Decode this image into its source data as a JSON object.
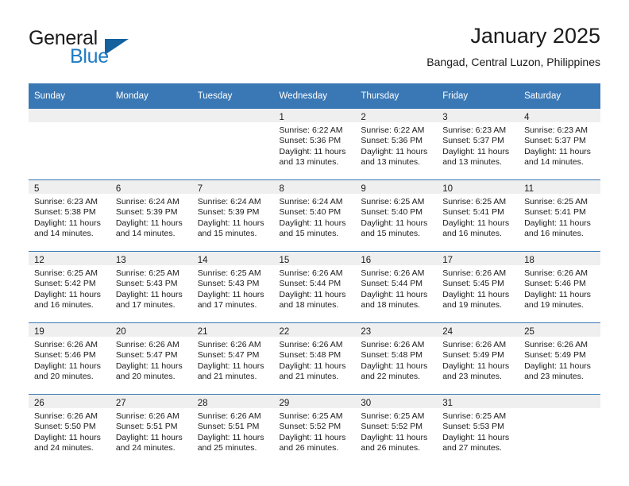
{
  "logo": {
    "word_one": "General",
    "word_two": "Blue",
    "triangle_color": "#15619e",
    "blue_color": "#1e7bc4"
  },
  "header": {
    "title": "January 2025",
    "subtitle": "Bangad, Central Luzon, Philippines"
  },
  "theme": {
    "header_bg": "#3a78b5",
    "daynum_bg": "#efefef",
    "grid_line": "#3a78b5",
    "text": "#1b1b1b"
  },
  "calendar": {
    "weekday_headers": [
      "Sunday",
      "Monday",
      "Tuesday",
      "Wednesday",
      "Thursday",
      "Friday",
      "Saturday"
    ],
    "weeks": [
      [
        {
          "day": "",
          "lines": []
        },
        {
          "day": "",
          "lines": []
        },
        {
          "day": "",
          "lines": []
        },
        {
          "day": "1",
          "lines": [
            "Sunrise: 6:22 AM",
            "Sunset: 5:36 PM",
            "Daylight: 11 hours and 13 minutes."
          ]
        },
        {
          "day": "2",
          "lines": [
            "Sunrise: 6:22 AM",
            "Sunset: 5:36 PM",
            "Daylight: 11 hours and 13 minutes."
          ]
        },
        {
          "day": "3",
          "lines": [
            "Sunrise: 6:23 AM",
            "Sunset: 5:37 PM",
            "Daylight: 11 hours and 13 minutes."
          ]
        },
        {
          "day": "4",
          "lines": [
            "Sunrise: 6:23 AM",
            "Sunset: 5:37 PM",
            "Daylight: 11 hours and 14 minutes."
          ]
        }
      ],
      [
        {
          "day": "5",
          "lines": [
            "Sunrise: 6:23 AM",
            "Sunset: 5:38 PM",
            "Daylight: 11 hours and 14 minutes."
          ]
        },
        {
          "day": "6",
          "lines": [
            "Sunrise: 6:24 AM",
            "Sunset: 5:39 PM",
            "Daylight: 11 hours and 14 minutes."
          ]
        },
        {
          "day": "7",
          "lines": [
            "Sunrise: 6:24 AM",
            "Sunset: 5:39 PM",
            "Daylight: 11 hours and 15 minutes."
          ]
        },
        {
          "day": "8",
          "lines": [
            "Sunrise: 6:24 AM",
            "Sunset: 5:40 PM",
            "Daylight: 11 hours and 15 minutes."
          ]
        },
        {
          "day": "9",
          "lines": [
            "Sunrise: 6:25 AM",
            "Sunset: 5:40 PM",
            "Daylight: 11 hours and 15 minutes."
          ]
        },
        {
          "day": "10",
          "lines": [
            "Sunrise: 6:25 AM",
            "Sunset: 5:41 PM",
            "Daylight: 11 hours and 16 minutes."
          ]
        },
        {
          "day": "11",
          "lines": [
            "Sunrise: 6:25 AM",
            "Sunset: 5:41 PM",
            "Daylight: 11 hours and 16 minutes."
          ]
        }
      ],
      [
        {
          "day": "12",
          "lines": [
            "Sunrise: 6:25 AM",
            "Sunset: 5:42 PM",
            "Daylight: 11 hours and 16 minutes."
          ]
        },
        {
          "day": "13",
          "lines": [
            "Sunrise: 6:25 AM",
            "Sunset: 5:43 PM",
            "Daylight: 11 hours and 17 minutes."
          ]
        },
        {
          "day": "14",
          "lines": [
            "Sunrise: 6:25 AM",
            "Sunset: 5:43 PM",
            "Daylight: 11 hours and 17 minutes."
          ]
        },
        {
          "day": "15",
          "lines": [
            "Sunrise: 6:26 AM",
            "Sunset: 5:44 PM",
            "Daylight: 11 hours and 18 minutes."
          ]
        },
        {
          "day": "16",
          "lines": [
            "Sunrise: 6:26 AM",
            "Sunset: 5:44 PM",
            "Daylight: 11 hours and 18 minutes."
          ]
        },
        {
          "day": "17",
          "lines": [
            "Sunrise: 6:26 AM",
            "Sunset: 5:45 PM",
            "Daylight: 11 hours and 19 minutes."
          ]
        },
        {
          "day": "18",
          "lines": [
            "Sunrise: 6:26 AM",
            "Sunset: 5:46 PM",
            "Daylight: 11 hours and 19 minutes."
          ]
        }
      ],
      [
        {
          "day": "19",
          "lines": [
            "Sunrise: 6:26 AM",
            "Sunset: 5:46 PM",
            "Daylight: 11 hours and 20 minutes."
          ]
        },
        {
          "day": "20",
          "lines": [
            "Sunrise: 6:26 AM",
            "Sunset: 5:47 PM",
            "Daylight: 11 hours and 20 minutes."
          ]
        },
        {
          "day": "21",
          "lines": [
            "Sunrise: 6:26 AM",
            "Sunset: 5:47 PM",
            "Daylight: 11 hours and 21 minutes."
          ]
        },
        {
          "day": "22",
          "lines": [
            "Sunrise: 6:26 AM",
            "Sunset: 5:48 PM",
            "Daylight: 11 hours and 21 minutes."
          ]
        },
        {
          "day": "23",
          "lines": [
            "Sunrise: 6:26 AM",
            "Sunset: 5:48 PM",
            "Daylight: 11 hours and 22 minutes."
          ]
        },
        {
          "day": "24",
          "lines": [
            "Sunrise: 6:26 AM",
            "Sunset: 5:49 PM",
            "Daylight: 11 hours and 23 minutes."
          ]
        },
        {
          "day": "25",
          "lines": [
            "Sunrise: 6:26 AM",
            "Sunset: 5:49 PM",
            "Daylight: 11 hours and 23 minutes."
          ]
        }
      ],
      [
        {
          "day": "26",
          "lines": [
            "Sunrise: 6:26 AM",
            "Sunset: 5:50 PM",
            "Daylight: 11 hours and 24 minutes."
          ]
        },
        {
          "day": "27",
          "lines": [
            "Sunrise: 6:26 AM",
            "Sunset: 5:51 PM",
            "Daylight: 11 hours and 24 minutes."
          ]
        },
        {
          "day": "28",
          "lines": [
            "Sunrise: 6:26 AM",
            "Sunset: 5:51 PM",
            "Daylight: 11 hours and 25 minutes."
          ]
        },
        {
          "day": "29",
          "lines": [
            "Sunrise: 6:25 AM",
            "Sunset: 5:52 PM",
            "Daylight: 11 hours and 26 minutes."
          ]
        },
        {
          "day": "30",
          "lines": [
            "Sunrise: 6:25 AM",
            "Sunset: 5:52 PM",
            "Daylight: 11 hours and 26 minutes."
          ]
        },
        {
          "day": "31",
          "lines": [
            "Sunrise: 6:25 AM",
            "Sunset: 5:53 PM",
            "Daylight: 11 hours and 27 minutes."
          ]
        },
        {
          "day": "",
          "lines": []
        }
      ]
    ]
  }
}
